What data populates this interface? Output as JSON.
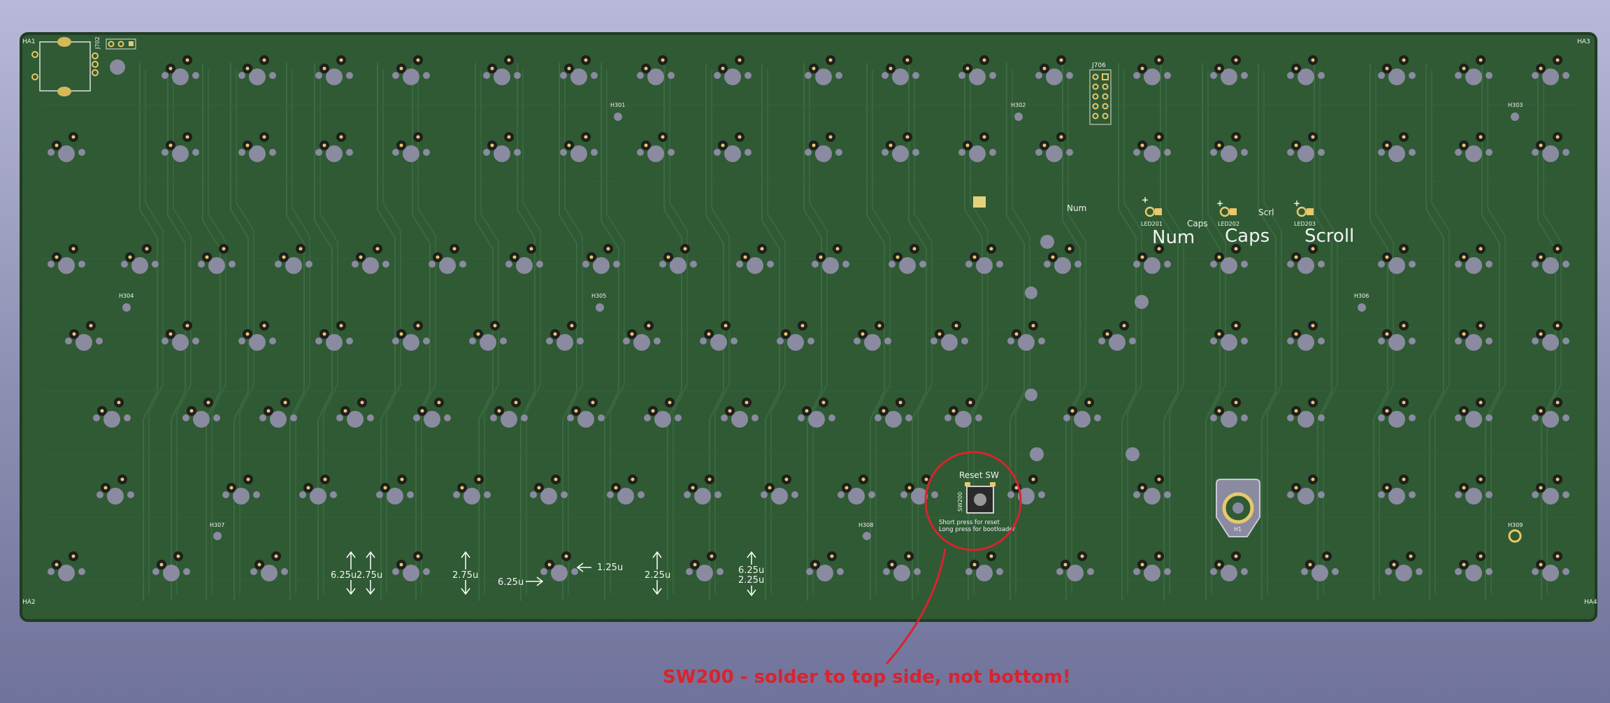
{
  "board": {
    "corner_labels": [
      "HA1",
      "HA3",
      "HA2",
      "HA4"
    ],
    "hole_labels": [
      "H301",
      "H302",
      "H303",
      "H304",
      "H305",
      "H306",
      "H307",
      "H308",
      "H309",
      "H1"
    ],
    "header_label": "J706",
    "connector_label": "J702",
    "led_labels": [
      "LED201",
      "LED202",
      "LED203"
    ],
    "led_small_labels": [
      "Num",
      "Caps",
      "Scrl"
    ],
    "led_big_labels": [
      "Num",
      "Caps",
      "Scroll"
    ],
    "plus_sign": "+",
    "reset": {
      "title": "Reset SW",
      "ref": "SW200",
      "line1": "Short press for reset",
      "line2": "Long press for bootloader"
    },
    "stab_labels": {
      "a": "6.25u",
      "b": "2.75u",
      "c": "2.75u",
      "d": "6.25u",
      "e": "1.25u",
      "f": "2.25u",
      "g": "6.25u",
      "h": "2.25u"
    }
  },
  "annotation": {
    "text": "SW200 - solder to top side, not bottom!",
    "color": "#d9232e"
  },
  "colors": {
    "pcb": "#2f5a34",
    "pcb_edge": "#1f3d22",
    "hole": "#8a8aa0",
    "pad": "#e8c86a",
    "silk": "#f2f2f2"
  }
}
